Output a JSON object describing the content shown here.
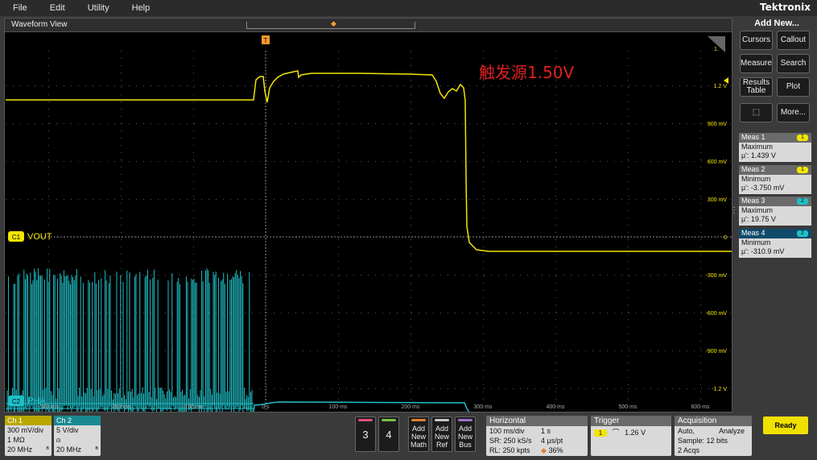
{
  "menu": {
    "items": [
      "File",
      "Edit",
      "Utility",
      "Help"
    ],
    "brand": "Tektronix"
  },
  "waveform_view": {
    "title": "Waveform View",
    "trigger_marker": "T",
    "annotation": "触发源1.50V",
    "ch1_label": "VOUT",
    "ch1_badge": "C1",
    "ch2_label": "PHA",
    "ch2_badge": "C2",
    "time_labels": [
      "-300 ms",
      "-200 ms",
      "-100 ms",
      "0 s",
      "100 ms",
      "200 ms",
      "300 ms",
      "400 ms",
      "500 ms",
      "600 ms"
    ],
    "volt_labels": [
      "1.2 V",
      "900 mV",
      "600 mV",
      "300 mV",
      "0",
      "-300 mV",
      "-600 mV",
      "-900 mV",
      "-1.2 V"
    ],
    "top_right_label": "1."
  },
  "sidebar": {
    "add_new": "Add New...",
    "buttons": [
      "Cursors",
      "Callout",
      "Measure",
      "Search",
      "Results Table",
      "Plot",
      "",
      "More..."
    ],
    "measurements": [
      {
        "title": "Meas 1",
        "badge": "1",
        "type": "Maximum",
        "value": "µ': 1.439 V"
      },
      {
        "title": "Meas 2",
        "badge": "1",
        "type": "Minimum",
        "value": "µ': -3.750 mV"
      },
      {
        "title": "Meas 3",
        "badge": "2",
        "type": "Maximum",
        "value": "µ': 19.75 V"
      },
      {
        "title": "Meas 4",
        "badge": "2",
        "type": "Minimum",
        "value": "µ': -310.9 mV"
      }
    ]
  },
  "bottom": {
    "ch1": {
      "title": "Ch 1",
      "scale": "300 mV/div",
      "impedance": "1 MΩ",
      "bandwidth": "20 MHz"
    },
    "ch2": {
      "title": "Ch 2",
      "scale": "5 V/div",
      "bandwidth": "20 MHz"
    },
    "num_buttons": [
      "3",
      "4"
    ],
    "add_buttons": [
      {
        "line1": "Add",
        "line2": "New",
        "line3": "Math"
      },
      {
        "line1": "Add",
        "line2": "New",
        "line3": "Ref"
      },
      {
        "line1": "Add",
        "line2": "New",
        "line3": "Bus"
      }
    ],
    "horizontal": {
      "title": "Horizontal",
      "scale": "100 ms/div",
      "length": "1 s",
      "sr": "SR: 250 kS/s",
      "pt": "4 µs/pt",
      "rl": "RL: 250 kpts",
      "pos": "36%"
    },
    "trigger": {
      "title": "Trigger",
      "source": "1",
      "level": "1.26 V"
    },
    "acquisition": {
      "title": "Acquisition",
      "mode": "Auto,",
      "action": "Analyze",
      "sample": "Sample: 12 bits",
      "acqs": "2 Acqs"
    },
    "status": "Ready"
  },
  "colors": {
    "ch1": "#f2e600",
    "ch2": "#20c0c8",
    "trigger": "#ff9a2e",
    "annotation": "#e02020"
  }
}
